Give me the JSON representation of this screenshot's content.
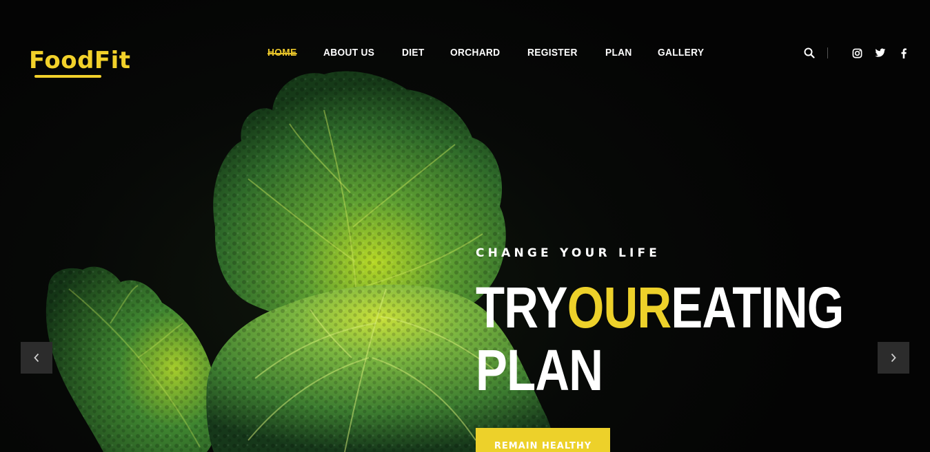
{
  "brand": {
    "name": "FoodFit",
    "accent_color": "#edd12a"
  },
  "nav": {
    "items": [
      {
        "label": "HOME",
        "active": true
      },
      {
        "label": "ABOUT US",
        "active": false
      },
      {
        "label": "DIET",
        "active": false
      },
      {
        "label": "ORCHARD",
        "active": false
      },
      {
        "label": "REGISTER",
        "active": false
      },
      {
        "label": "PLAN",
        "active": false
      },
      {
        "label": "GALLERY",
        "active": false
      }
    ]
  },
  "header_icons": [
    "search-icon",
    "instagram-icon",
    "twitter-icon",
    "facebook-icon"
  ],
  "hero": {
    "kicker": "CHANGE YOUR LIFE",
    "headline_part1": "TRY",
    "headline_accent": "OUR",
    "headline_part2": "EATING",
    "headline_line2": "PLAN",
    "cta_label": "REMAIN HEALTHY",
    "prev_icon": "chevron-left-icon",
    "next_icon": "chevron-right-icon"
  }
}
